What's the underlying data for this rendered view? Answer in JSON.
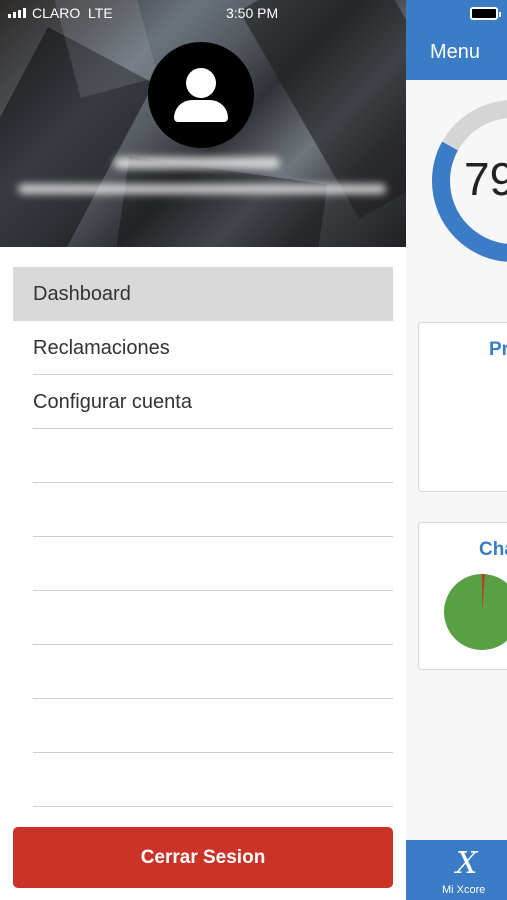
{
  "status_bar": {
    "carrier": "CLARO",
    "network": "LTE",
    "time": "3:50 PM"
  },
  "drawer": {
    "menu_items": [
      {
        "label": "Dashboard",
        "active": true
      },
      {
        "label": "Reclamaciones",
        "active": false
      },
      {
        "label": "Configurar cuenta",
        "active": false
      },
      {
        "label": "",
        "active": false
      },
      {
        "label": "",
        "active": false
      },
      {
        "label": "",
        "active": false
      },
      {
        "label": "",
        "active": false
      },
      {
        "label": "",
        "active": false
      },
      {
        "label": "",
        "active": false
      },
      {
        "label": "",
        "active": false
      }
    ],
    "logout_label": "Cerrar Sesion"
  },
  "main": {
    "menu_label": "Menu",
    "score_text": "79",
    "card1_title": "Pr",
    "card2_title": "Cha",
    "bottom_tab_label": "Mi Xcore",
    "bottom_tab_icon": "X"
  },
  "colors": {
    "brand_blue": "#3a7cc6",
    "logout_red": "#cc3328",
    "active_item_bg": "#d9d9d9",
    "pie_green": "#58a043",
    "pie_red": "#c0392b"
  }
}
